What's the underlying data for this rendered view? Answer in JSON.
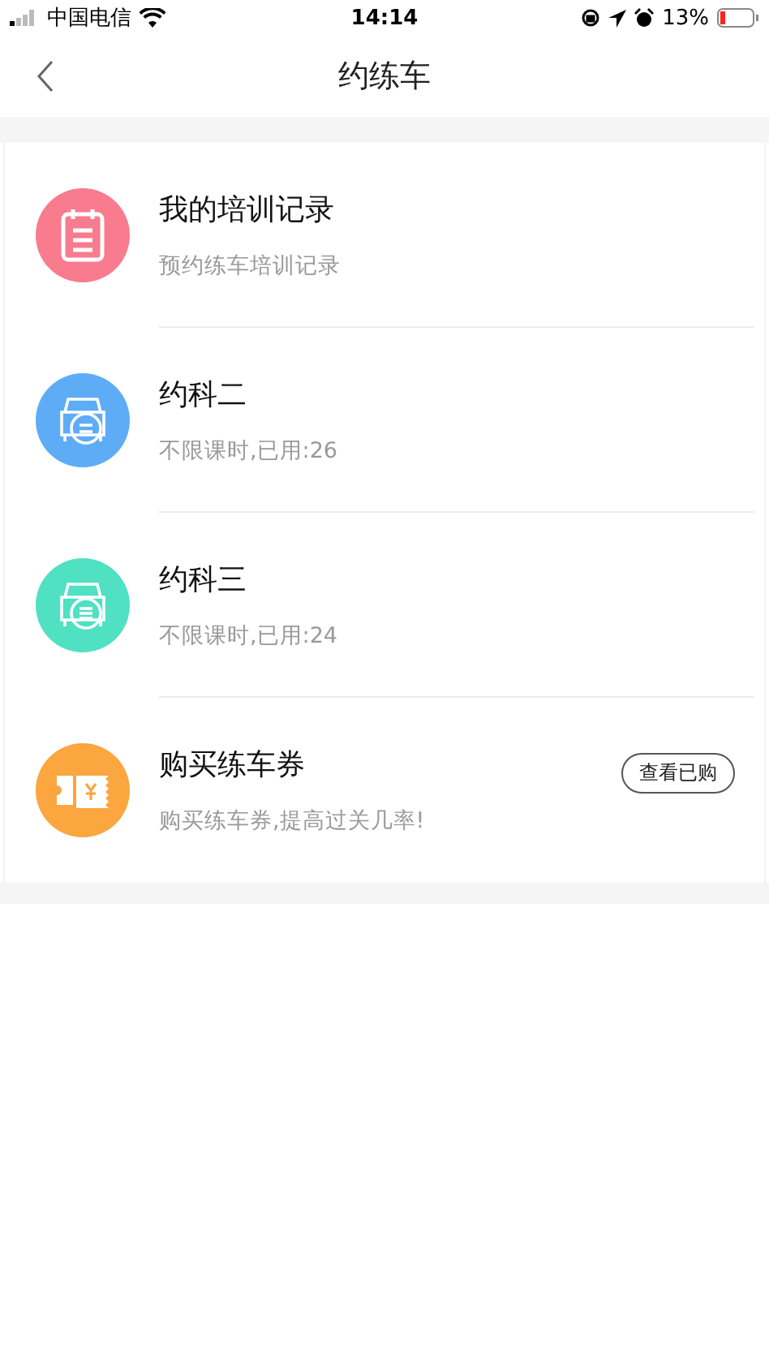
{
  "status_bar": {
    "carrier": "中国电信",
    "time": "14:14",
    "battery": "13%"
  },
  "nav": {
    "title": "约练车"
  },
  "items": [
    {
      "kind": "record",
      "color": "#f87b8e",
      "title": "我的培训记录",
      "subtitle": "预约练车培训记录"
    },
    {
      "kind": "car2",
      "color": "#5eacf6",
      "title": "约科二",
      "subtitle": "不限课时,已用:26"
    },
    {
      "kind": "car3",
      "color": "#50e0c2",
      "title": "约科三",
      "subtitle": "不限课时,已用:24"
    },
    {
      "kind": "ticket",
      "color": "#fba63e",
      "title": "购买练车券",
      "subtitle": "购买练车券,提高过关几率!",
      "action": "查看已购"
    }
  ]
}
